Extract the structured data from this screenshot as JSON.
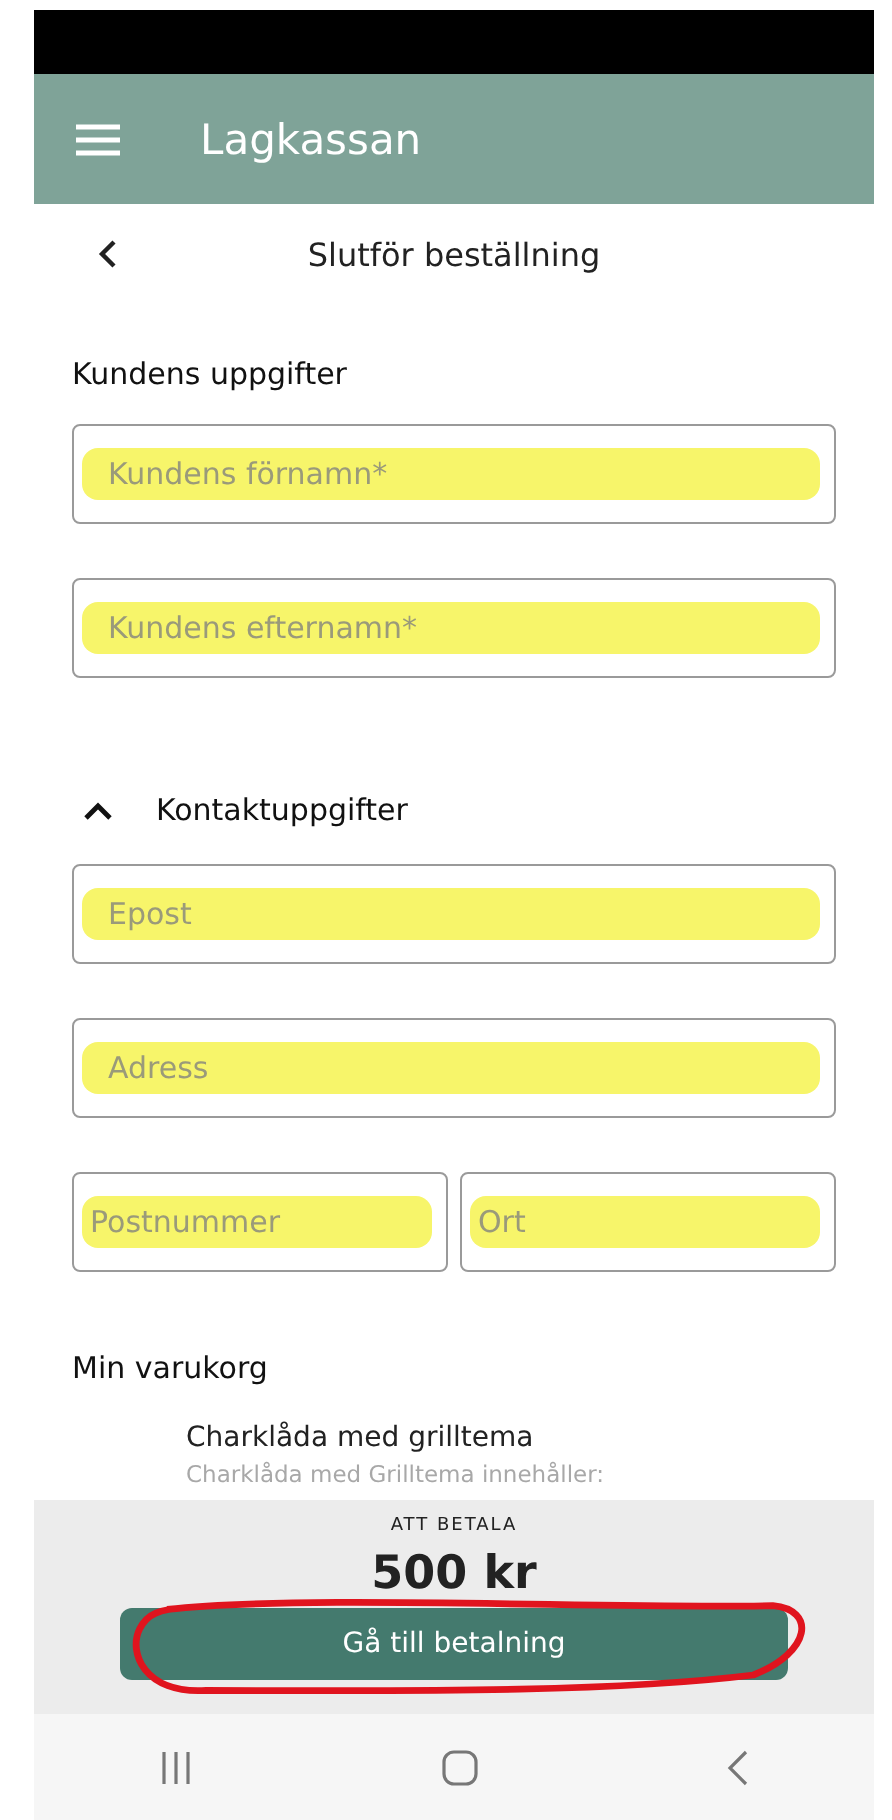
{
  "app_bar": {
    "title": "Lagkassan"
  },
  "page_header": {
    "title": "Slutför beställning"
  },
  "customer_section": {
    "title": "Kundens uppgifter",
    "fields": [
      {
        "placeholder": "Kundens förnamn*",
        "highlighted": true
      },
      {
        "placeholder": "Kundens efternamn*",
        "highlighted": true
      }
    ]
  },
  "contact_section": {
    "title": "Kontaktuppgifter",
    "expanded": true,
    "fields": [
      {
        "placeholder": "Epost",
        "highlighted": true,
        "kind": "full"
      },
      {
        "placeholder": "Adress",
        "highlighted": true,
        "kind": "full"
      },
      {
        "placeholder": "Postnummer",
        "highlighted": true,
        "kind": "half"
      },
      {
        "placeholder": "Ort",
        "highlighted": true,
        "kind": "half"
      }
    ]
  },
  "cart": {
    "title": "Min varukorg",
    "items": [
      {
        "name": "Charklåda med grilltema",
        "description": "Charklåda med Grilltema innehåller:"
      }
    ]
  },
  "checkout": {
    "label": "ATT BETALA",
    "total": "500 kr",
    "button": "Gå till betalning",
    "circled": true
  }
}
